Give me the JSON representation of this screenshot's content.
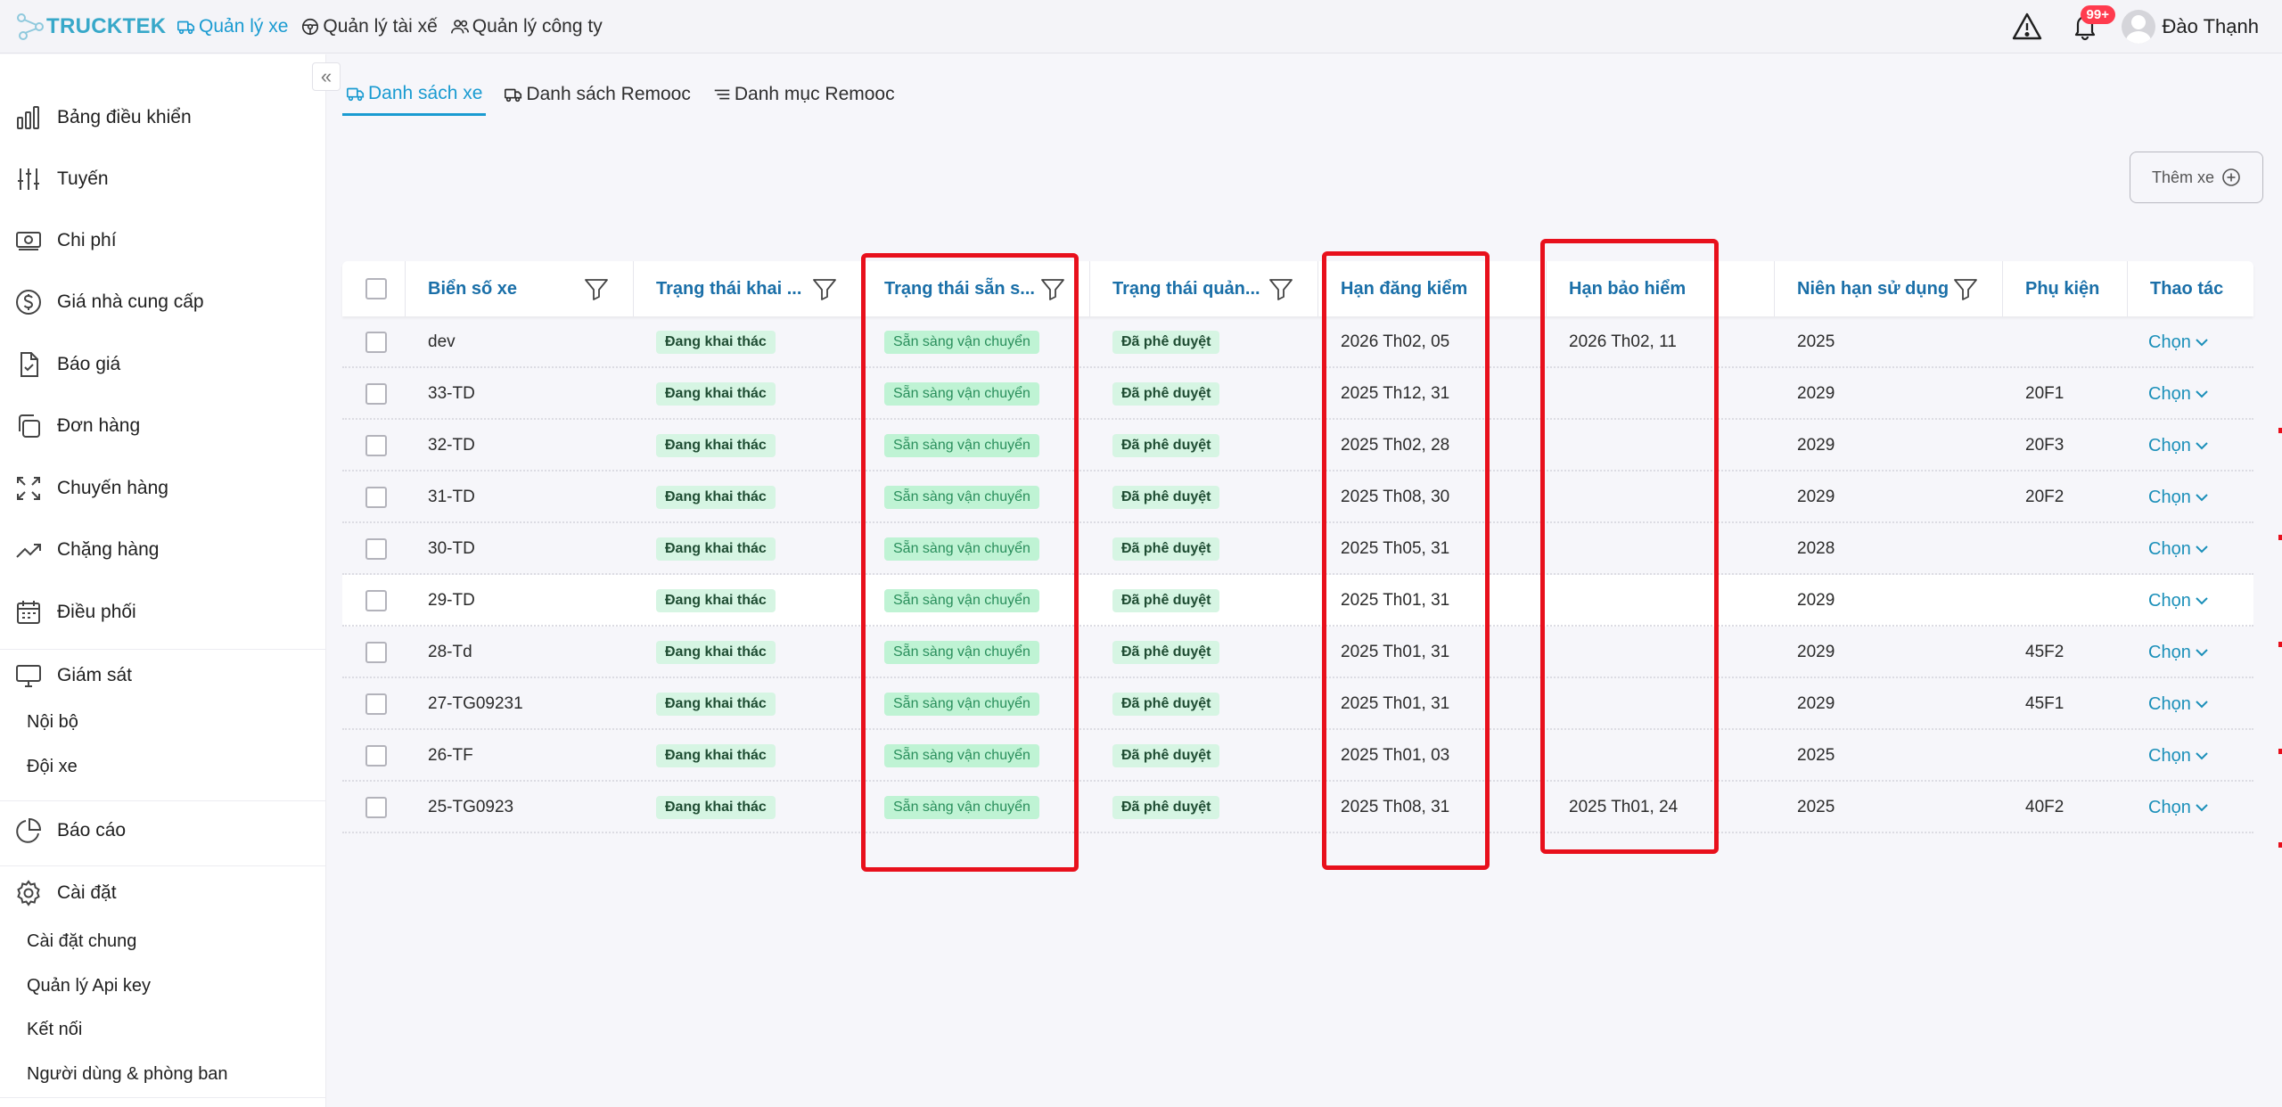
{
  "topbar": {
    "brand": "TRUCKTEK",
    "nav": [
      {
        "label": "Quản lý xe",
        "icon": "truck-icon",
        "active": true
      },
      {
        "label": "Quản lý tài xế",
        "icon": "steering-wheel-icon",
        "active": false
      },
      {
        "label": "Quản lý công ty",
        "icon": "users-icon",
        "active": false
      }
    ],
    "notification_count": "99+",
    "user_name": "Đào Thạnh"
  },
  "sidebar": {
    "items": [
      {
        "label": "Bảng điều khiển",
        "icon": "chart-bar-icon"
      },
      {
        "label": "Tuyến",
        "icon": "sliders-icon"
      },
      {
        "label": "Chi phí",
        "icon": "money-icon"
      },
      {
        "label": "Giá nhà cung cấp",
        "icon": "dollar-circle-icon"
      },
      {
        "label": "Báo giá",
        "icon": "file-check-icon"
      },
      {
        "label": "Đơn hàng",
        "icon": "copy-icon"
      },
      {
        "label": "Chuyến hàng",
        "icon": "expand-icon"
      },
      {
        "label": "Chặng hàng",
        "icon": "trend-icon"
      },
      {
        "label": "Điều phối",
        "icon": "calendar-icon"
      },
      {
        "label": "Giám sát",
        "icon": "monitor-icon"
      },
      {
        "label": "Báo cáo",
        "icon": "pie-chart-icon"
      },
      {
        "label": "Cài đặt",
        "icon": "gear-icon"
      }
    ],
    "giam_sat_sub": [
      "Nội bộ",
      "Đội xe"
    ],
    "cai_dat_sub": [
      "Cài đặt chung",
      "Quản lý Api key",
      "Kết nối",
      "Người dùng & phòng ban"
    ]
  },
  "tabs": [
    {
      "label": "Danh sách xe",
      "active": true
    },
    {
      "label": "Danh sách Remooc",
      "active": false
    },
    {
      "label": "Danh mục Remooc",
      "active": false
    }
  ],
  "add_button": "Thêm xe",
  "table": {
    "headers": {
      "plate": "Biển số xe",
      "operation_status": "Trạng thái khai ...",
      "ready_status": "Trạng thái sẵn s...",
      "management_status": "Trạng thái quản...",
      "inspection_deadline": "Hạn đăng kiểm",
      "insurance_deadline": "Hạn bảo hiểm",
      "service_life": "Niên hạn sử dụng",
      "accessories": "Phụ kiện",
      "actions": "Thao tác"
    },
    "rows": [
      {
        "plate": "dev",
        "operation": "Đang khai thác",
        "ready": "Sẵn sàng vận chuyển",
        "management": "Đã phê duyệt",
        "inspection": "2026 Th02, 05",
        "insurance": "2026 Th02, 11",
        "life": "2025",
        "accessory": "",
        "action": "Chọn"
      },
      {
        "plate": "33-TD",
        "operation": "Đang khai thác",
        "ready": "Sẵn sàng vận chuyển",
        "management": "Đã phê duyệt",
        "inspection": "2025 Th12, 31",
        "insurance": "",
        "life": "2029",
        "accessory": "20F1",
        "action": "Chọn"
      },
      {
        "plate": "32-TD",
        "operation": "Đang khai thác",
        "ready": "Sẵn sàng vận chuyển",
        "management": "Đã phê duyệt",
        "inspection": "2025 Th02, 28",
        "insurance": "",
        "life": "2029",
        "accessory": "20F3",
        "action": "Chọn"
      },
      {
        "plate": "31-TD",
        "operation": "Đang khai thác",
        "ready": "Sẵn sàng vận chuyển",
        "management": "Đã phê duyệt",
        "inspection": "2025 Th08, 30",
        "insurance": "",
        "life": "2029",
        "accessory": "20F2",
        "action": "Chọn"
      },
      {
        "plate": "30-TD",
        "operation": "Đang khai thác",
        "ready": "Sẵn sàng vận chuyển",
        "management": "Đã phê duyệt",
        "inspection": "2025 Th05, 31",
        "insurance": "",
        "life": "2028",
        "accessory": "",
        "action": "Chọn"
      },
      {
        "plate": "29-TD",
        "operation": "Đang khai thác",
        "ready": "Sẵn sàng vận chuyển",
        "management": "Đã phê duyệt",
        "inspection": "2025 Th01, 31",
        "insurance": "",
        "life": "2029",
        "accessory": "",
        "action": "Chọn"
      },
      {
        "plate": "28-Td",
        "operation": "Đang khai thác",
        "ready": "Sẵn sàng vận chuyển",
        "management": "Đã phê duyệt",
        "inspection": "2025 Th01, 31",
        "insurance": "",
        "life": "2029",
        "accessory": "45F2",
        "action": "Chọn"
      },
      {
        "plate": "27-TG09231",
        "operation": "Đang khai thác",
        "ready": "Sẵn sàng vận chuyển",
        "management": "Đã phê duyệt",
        "inspection": "2025 Th01, 31",
        "insurance": "",
        "life": "2029",
        "accessory": "45F1",
        "action": "Chọn"
      },
      {
        "plate": "26-TF",
        "operation": "Đang khai thác",
        "ready": "Sẵn sàng vận chuyển",
        "management": "Đã phê duyệt",
        "inspection": "2025 Th01, 03",
        "insurance": "",
        "life": "2025",
        "accessory": "",
        "action": "Chọn"
      },
      {
        "plate": "25-TG0923",
        "operation": "Đang khai thác",
        "ready": "Sẵn sàng vận chuyển",
        "management": "Đã phê duyệt",
        "inspection": "2025 Th08, 31",
        "insurance": "2025 Th01, 24",
        "life": "2025",
        "accessory": "40F2",
        "action": "Chọn"
      }
    ]
  },
  "colors": {
    "accent": "#1a9bd1",
    "header_text": "#1a6fa8",
    "highlight_box": "#e8101c",
    "tag_bg": "#d6f5e3",
    "badge": "#ff3b4e"
  }
}
